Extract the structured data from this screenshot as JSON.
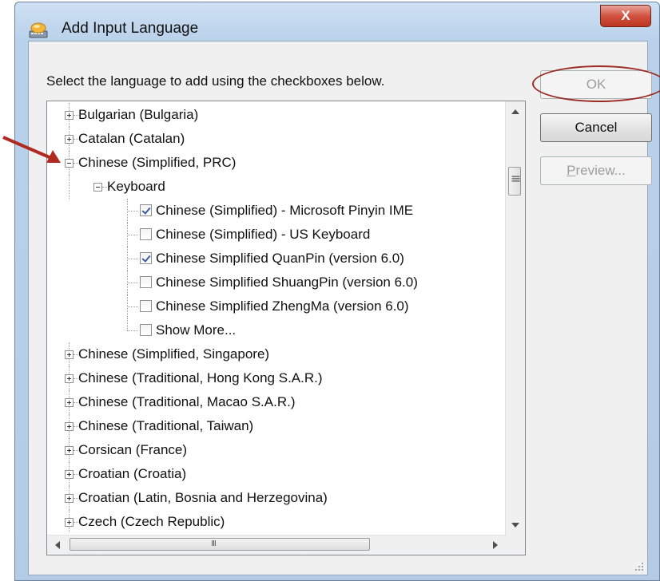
{
  "window": {
    "title": "Add Input Language",
    "close_label": "X"
  },
  "dialog": {
    "instruction": "Select the language to add using the checkboxes below.",
    "ok_label": "OK",
    "cancel_label": "Cancel",
    "preview_label_first": "P",
    "preview_label_rest": "review..."
  },
  "tree": {
    "rows": [
      {
        "label": "Bulgarian (Bulgaria)",
        "level": 0,
        "expander": "plus"
      },
      {
        "label": "Catalan (Catalan)",
        "level": 0,
        "expander": "plus"
      },
      {
        "label": "Chinese (Simplified, PRC)",
        "level": 0,
        "expander": "minus"
      },
      {
        "label": "Keyboard",
        "level": 1,
        "expander": "minus"
      },
      {
        "label": "Chinese (Simplified) - Microsoft Pinyin IME",
        "level": 2,
        "checkbox": true,
        "checked": true
      },
      {
        "label": "Chinese (Simplified) - US Keyboard",
        "level": 2,
        "checkbox": true,
        "checked": false
      },
      {
        "label": "Chinese Simplified QuanPin (version 6.0)",
        "level": 2,
        "checkbox": true,
        "checked": true
      },
      {
        "label": "Chinese Simplified ShuangPin (version 6.0)",
        "level": 2,
        "checkbox": true,
        "checked": false
      },
      {
        "label": "Chinese Simplified ZhengMa (version 6.0)",
        "level": 2,
        "checkbox": true,
        "checked": false
      },
      {
        "label": "Show More...",
        "level": 2,
        "checkbox": true,
        "checked": false
      },
      {
        "label": "Chinese (Simplified, Singapore)",
        "level": 0,
        "expander": "plus"
      },
      {
        "label": "Chinese (Traditional, Hong Kong S.A.R.)",
        "level": 0,
        "expander": "plus"
      },
      {
        "label": "Chinese (Traditional, Macao S.A.R.)",
        "level": 0,
        "expander": "plus"
      },
      {
        "label": "Chinese (Traditional, Taiwan)",
        "level": 0,
        "expander": "plus"
      },
      {
        "label": "Corsican (France)",
        "level": 0,
        "expander": "plus"
      },
      {
        "label": "Croatian (Croatia)",
        "level": 0,
        "expander": "plus"
      },
      {
        "label": "Croatian (Latin, Bosnia and Herzegovina)",
        "level": 0,
        "expander": "plus"
      },
      {
        "label": "Czech (Czech Republic)",
        "level": 0,
        "expander": "plus"
      }
    ]
  },
  "colors": {
    "annotation_red": "#b02a22",
    "check_blue": "#3a5e9b"
  }
}
